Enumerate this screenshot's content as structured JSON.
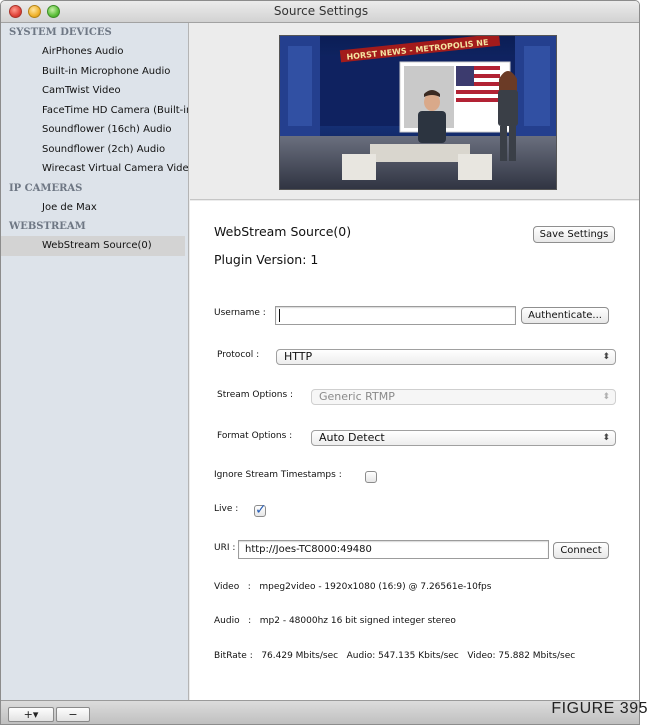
{
  "window": {
    "title": "Source Settings"
  },
  "sidebar": {
    "groups": [
      {
        "label": "SYSTEM DEVICES",
        "items": [
          "AirPhones Audio",
          "Built-in Microphone Audio",
          "CamTwist Video",
          "FaceTime HD Camera (Built-in",
          "Soundflower (16ch) Audio",
          "Soundflower (2ch) Audio",
          "Wirecast Virtual Camera Video"
        ]
      },
      {
        "label": "IP CAMERAS",
        "items": [
          "Joe de Max"
        ]
      },
      {
        "label": "WEBSTREAM",
        "items": [
          "WebStream Source(0)"
        ]
      }
    ],
    "selected": "WebStream Source(0)"
  },
  "bottom_bar": {
    "add_label": "+▾",
    "remove_label": "−"
  },
  "figure_label": "FIGURE 395",
  "preview": {
    "banner_text": "HORST NEWS - METROPOLIS NE"
  },
  "source": {
    "title": "WebStream Source(0)",
    "plugin_version": "Plugin Version: 1",
    "save_label": "Save Settings"
  },
  "form": {
    "username_label": "Username :",
    "username_value": "",
    "authenticate_label": "Authenticate...",
    "protocol_label": "Protocol :",
    "protocol_value": "HTTP",
    "stream_options_label": "Stream Options :",
    "stream_options_value": "Generic RTMP",
    "format_options_label": "Format Options :",
    "format_options_value": "Auto Detect",
    "ignore_timestamps_label": "Ignore Stream Timestamps :",
    "ignore_timestamps_checked": false,
    "live_label": "Live :",
    "live_checked": true,
    "uri_label": "URI :",
    "uri_value": "http://Joes-TC8000:49480",
    "connect_label": "Connect"
  },
  "info": {
    "video": "Video   :   mpeg2video - 1920x1080 (16:9) @ 7.26561e-10fps",
    "audio": "Audio   :   mp2 - 48000hz 16 bit signed integer stereo",
    "bitrate": "BitRate :   76.429 Mbits/sec   Audio: 547.135 Kbits/sec   Video: 75.882 Mbits/sec"
  },
  "colors": {
    "sidebar_bg": "#dde3ea",
    "selected_row": "#d3d3d3",
    "checkmark": "#2a5fb5"
  }
}
